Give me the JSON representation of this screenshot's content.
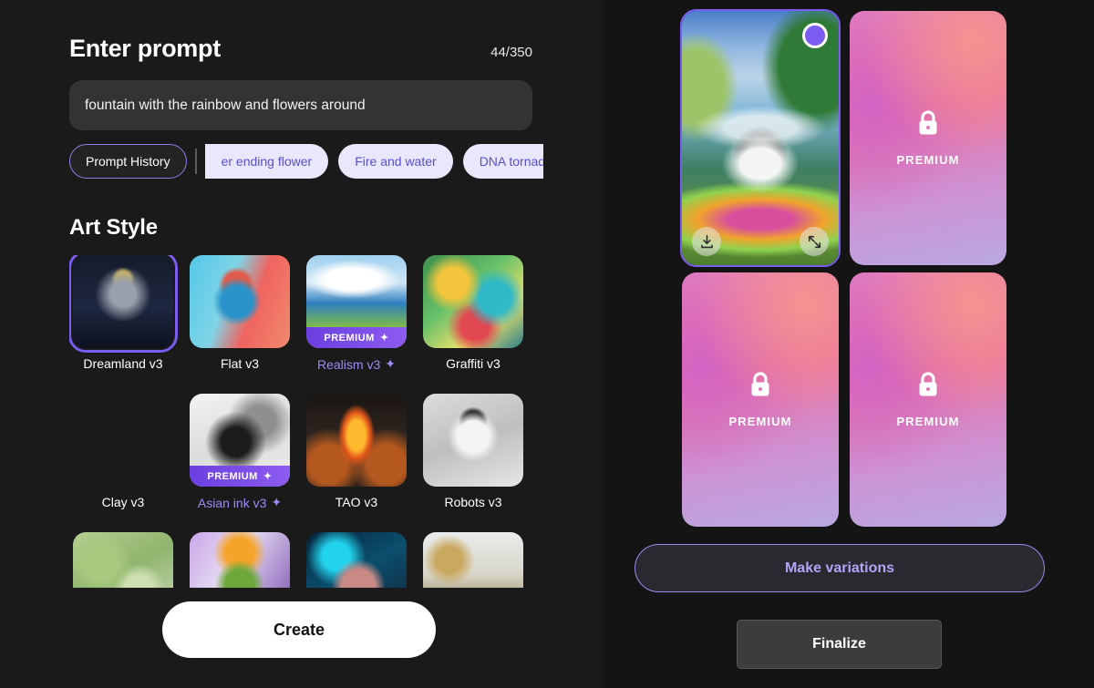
{
  "prompt": {
    "title": "Enter prompt",
    "counter": "44/350",
    "value": "fountain with the rainbow and flowers around",
    "placeholder": "Enter prompt"
  },
  "chips": {
    "history_label": "Prompt History",
    "items": [
      {
        "label": "er ending flower",
        "clipped": true
      },
      {
        "label": "Fire and water",
        "clipped": false
      },
      {
        "label": "DNA tornado",
        "clipped": false
      }
    ]
  },
  "art_style": {
    "title": "Art Style",
    "premium_badge": "PREMIUM",
    "sparkle": "✦",
    "items": [
      {
        "label": "Dreamland v3",
        "premium": false,
        "selected": true,
        "art": "cat-king"
      },
      {
        "label": "Flat v3",
        "premium": false,
        "selected": false,
        "art": "flat-koala"
      },
      {
        "label": "Realism v3",
        "premium": true,
        "selected": false,
        "art": "coast"
      },
      {
        "label": "Graffiti v3",
        "premium": false,
        "selected": false,
        "art": "graffiti"
      },
      {
        "label": "Clay v3",
        "premium": false,
        "selected": false,
        "art": "clay"
      },
      {
        "label": "Asian ink v3",
        "premium": true,
        "selected": false,
        "art": "ink"
      },
      {
        "label": "TAO v3",
        "premium": false,
        "selected": false,
        "art": "tao-fire"
      },
      {
        "label": "Robots v3",
        "premium": false,
        "selected": false,
        "art": "robot-panda"
      },
      {
        "label": "",
        "premium": false,
        "selected": false,
        "art": "moss-river"
      },
      {
        "label": "",
        "premium": false,
        "selected": false,
        "art": "goblin"
      },
      {
        "label": "",
        "premium": false,
        "selected": false,
        "art": "neon-pig"
      },
      {
        "label": "",
        "premium": false,
        "selected": false,
        "art": "pier"
      }
    ]
  },
  "create_button": "Create",
  "results": {
    "cards": [
      {
        "type": "image",
        "locked": false,
        "selected": true,
        "label": ""
      },
      {
        "type": "locked",
        "locked": true,
        "selected": false,
        "label": "PREMIUM"
      },
      {
        "type": "locked",
        "locked": true,
        "selected": false,
        "label": "PREMIUM"
      },
      {
        "type": "locked",
        "locked": true,
        "selected": false,
        "label": "PREMIUM"
      }
    ]
  },
  "actions": {
    "make_variations": "Make variations",
    "finalize": "Finalize"
  },
  "colors": {
    "background": "#141414",
    "panel": "#1a1a1a",
    "accent_purple": "#7b5cf0",
    "accent_purple_light": "#b3a4f7",
    "chip_bg": "#e9e7fb",
    "chip_text": "#5a4fcf",
    "premium_pink": "#ea6f9e",
    "premium_lavender": "#b9a8e2"
  }
}
